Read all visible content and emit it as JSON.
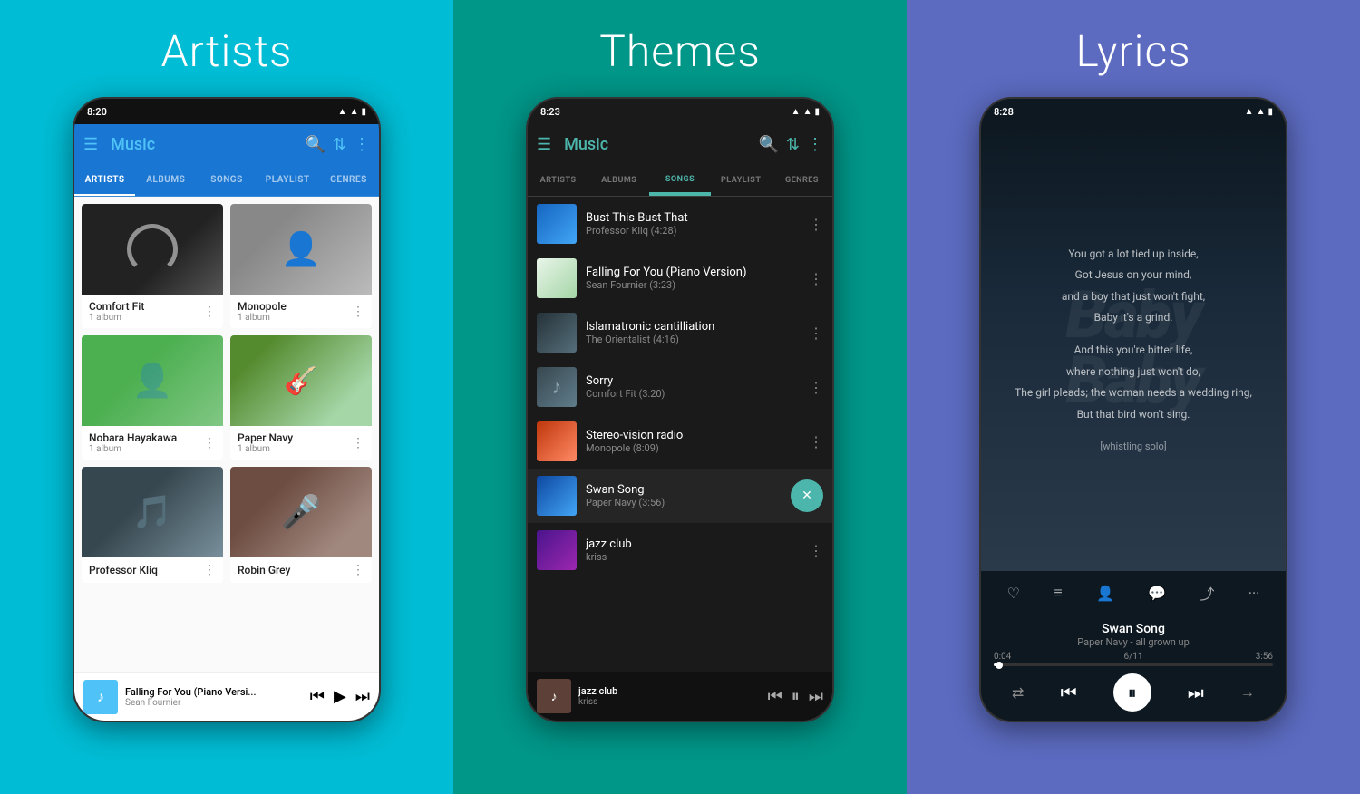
{
  "panels": {
    "artists": {
      "title": "Artists",
      "time": "8:20",
      "app_title": "Music",
      "tabs": [
        "ARTISTS",
        "ALBUMS",
        "SONGS",
        "PLAYLIST",
        "GENRES"
      ],
      "active_tab": "ARTISTS",
      "artists": [
        {
          "name": "Comfort Fit",
          "sub": "1 album",
          "img_type": "comfort"
        },
        {
          "name": "Monopole",
          "sub": "1 album",
          "img_type": "monopole"
        },
        {
          "name": "Nobara Hayakawa",
          "sub": "1 album",
          "img_type": "nobara"
        },
        {
          "name": "Paper Navy",
          "sub": "1 album",
          "img_type": "papernavy"
        },
        {
          "name": "Professor Kliq",
          "sub": "",
          "img_type": "professorkliq"
        },
        {
          "name": "Robin Grey",
          "sub": "",
          "img_type": "robingrey"
        }
      ],
      "mini_player": {
        "title": "Falling For You (Piano Versi...",
        "artist": "Sean Fournier"
      }
    },
    "themes": {
      "title": "Themes",
      "time": "8:23",
      "app_title": "Music",
      "tabs": [
        "ARTISTS",
        "ALBUMS",
        "SONGS",
        "PLAYLIST",
        "GENRES"
      ],
      "active_tab": "SONGS",
      "songs": [
        {
          "title": "Bust This Bust That",
          "meta": "Professor Kliq (4:28)",
          "art_type": "bust"
        },
        {
          "title": "Falling For You (Piano Version)",
          "meta": "Sean Fournier (3:23)",
          "art_type": "falling"
        },
        {
          "title": "Islamatronic cantilliation",
          "meta": "The Orientalist (4:16)",
          "art_type": "islamatronic"
        },
        {
          "title": "Sorry",
          "meta": "Comfort Fit (3:20)",
          "art_type": "sorry"
        },
        {
          "title": "Stereo-vision radio",
          "meta": "Monopole (8:09)",
          "art_type": "stereo"
        },
        {
          "title": "Swan Song",
          "meta": "Paper Navy (3:56)",
          "art_type": "swan",
          "active": true
        },
        {
          "title": "jazz club",
          "meta": "kriss",
          "art_type": "jazz"
        }
      ],
      "mini_player": {
        "title": "jazz club",
        "artist": "kriss"
      }
    },
    "lyrics": {
      "title": "Lyrics",
      "time": "8:28",
      "lyrics_lines": [
        "You got a lot tied up inside,",
        "Got Jesus on your mind,",
        "and a boy that just won't fight,",
        "Baby it's a grind.",
        "",
        "And this you're bitter life,",
        "where nothing just won't do,",
        "The girl pleads; the woman needs a wedding ring,",
        "But that bird won't sing.",
        "",
        "[whistling solo]"
      ],
      "bg_text": "Baby",
      "song_title": "Swan Song",
      "song_sub": "Paper Navy - all grown up",
      "progress_time": "0:04",
      "duration": "3:56",
      "progress_count": "6/11",
      "progress_pct": 2
    }
  }
}
